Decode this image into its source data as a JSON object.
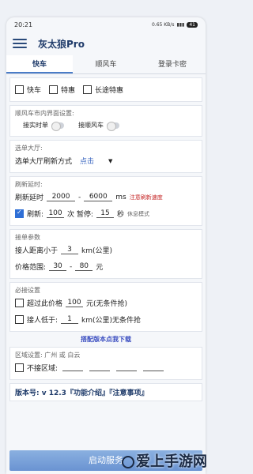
{
  "status": {
    "time": "20:21",
    "net": "0.65 KB/s",
    "battery": "41"
  },
  "app": {
    "title": "灰太狼Pro"
  },
  "tabs": [
    {
      "label": "快车"
    },
    {
      "label": "顺风车"
    },
    {
      "label": "登录卡密"
    }
  ],
  "types": {
    "fast": "快车",
    "special": "特惠",
    "long": "长途特惠"
  },
  "sfc": {
    "title": "顺风车市内界面设置:",
    "realtime": "接实时单",
    "ride": "接顺风车"
  },
  "hall": {
    "title": "选单大厅:",
    "mode_label": "选单大厅刷新方式",
    "mode_value": "点击"
  },
  "delay": {
    "title": "刷新延时:",
    "label": "刷新延时",
    "min": "2000",
    "max": "6000",
    "unit": "ms",
    "note": "注意刷新速度"
  },
  "refresh": {
    "label": "刷新:",
    "count": "100",
    "count_unit": "次 暂停:",
    "pause": "15",
    "pause_unit": "秒",
    "rest": "休息模式"
  },
  "params": {
    "title": "接单参数",
    "dist_label": "接人距离小于",
    "dist": "3",
    "dist_unit": "km(公里)",
    "price_label": "价格范围:",
    "price_min": "30",
    "price_max": "80",
    "price_unit": "元"
  },
  "must": {
    "title": "必接设置",
    "price_label": "超过此价格",
    "price": "100",
    "price_unit": "元(无条件抢)",
    "near_label": "接人低于:",
    "near": "1",
    "near_unit": "km(公里)无条件抢"
  },
  "banner": "搭配版本点我下载",
  "area": {
    "title": "区域设置: 广州 或 白云",
    "exclude": "不接区域:"
  },
  "version": {
    "text": "版本号: v 12.3『功能介绍』『注意事项』"
  },
  "start": "启动服务",
  "watermark": "爱上手游网"
}
